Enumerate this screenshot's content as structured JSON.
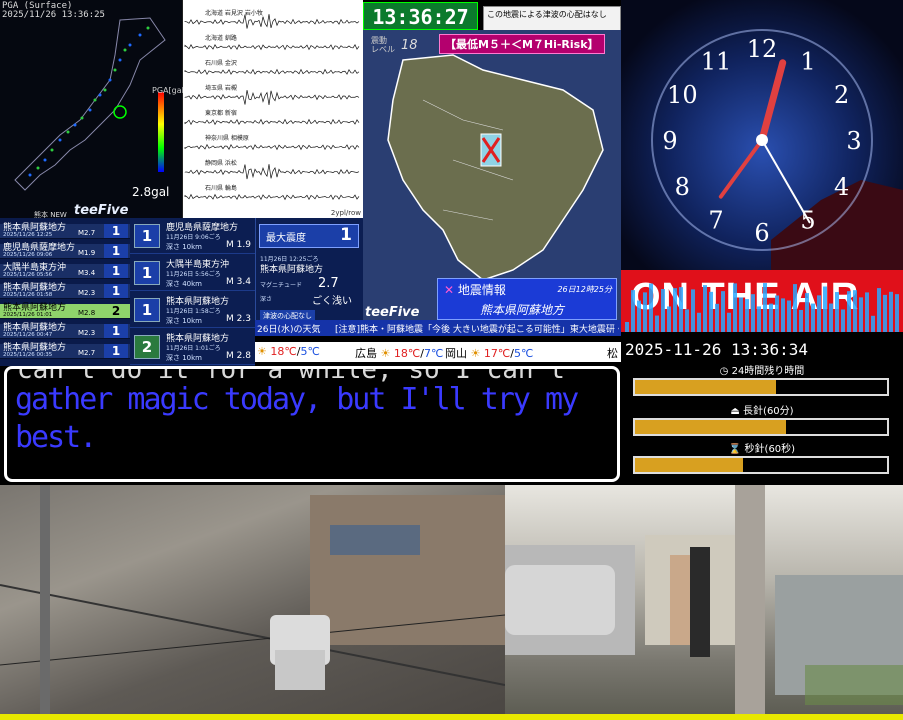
{
  "map_panel": {
    "header_title": "PGA (Surface)",
    "timestamp": "2025/11/26 13:36:25",
    "pga_label": "PGA[gal]",
    "gal_value": "2.8gal",
    "brand": "teeFive",
    "scale_labels": [
      "1000",
      "500",
      "200",
      "100",
      "50",
      "20",
      "10",
      "5",
      "2",
      "1",
      "0.5",
      "0.2",
      "0.1",
      "0.05",
      "0.02",
      "0.01"
    ]
  },
  "waveform_panel": {
    "stations": [
      "北海道 岩見沢 岩小牧",
      "北海道 釧路",
      "石川県 金沢",
      "埼玉県 岩槻",
      "東京都 新宿",
      "神奈川県 相模原",
      "静岡県 浜松",
      "石川県 輪島"
    ],
    "footer": "2ypl/row"
  },
  "clock_green": "13:36:27",
  "tsunami_notice": "この地震による津波の心配はなし",
  "kyushu_panel": {
    "shindo_label": "震動\nレベル",
    "shindo_value": "18",
    "risk_label": "【最低M５＋＜M７Hi-Risk】",
    "info_title": "地震情報",
    "info_time": "26日12時25分",
    "info_place": "熊本県阿蘇地方",
    "brand": "teeFive"
  },
  "quake_list": {
    "new_label": "熊本 NEW",
    "rows": [
      {
        "place": "熊本県阿蘇地方",
        "date": "2025/11/26 12:25",
        "mag": "M2.7",
        "shindo": "1",
        "highlight": false
      },
      {
        "place": "鹿児島県薩摩地方",
        "date": "2025/11/26 09:06",
        "mag": "M1.9",
        "shindo": "1",
        "highlight": false
      },
      {
        "place": "大隅半島東方沖",
        "date": "2025/11/26 05:56",
        "mag": "M3.4",
        "shindo": "1",
        "highlight": false
      },
      {
        "place": "熊本県阿蘇地方",
        "date": "2025/11/26 01:58",
        "mag": "M2.3",
        "shindo": "1",
        "highlight": false
      },
      {
        "place": "熊本県阿蘇地方",
        "date": "2025/11/26 01:01",
        "mag": "M2.8",
        "shindo": "2",
        "highlight": true
      },
      {
        "place": "熊本県阿蘇地方",
        "date": "2025/11/26 00:47",
        "mag": "M2.3",
        "shindo": "1",
        "highlight": false
      },
      {
        "place": "熊本県阿蘇地方",
        "date": "2025/11/26 00:35",
        "mag": "M2.7",
        "shindo": "1",
        "highlight": false
      }
    ]
  },
  "detail_list": {
    "rows": [
      {
        "place": "鹿児島県薩摩地方",
        "time": "11月26日 9:06ごろ",
        "depth": "深さ 10km",
        "mag": "M 1.9",
        "shindo": "1",
        "highlight": false
      },
      {
        "place": "大隅半島東方沖",
        "time": "11月26日 5:56ごろ",
        "depth": "深さ 40km",
        "mag": "M 3.4",
        "shindo": "1",
        "highlight": false
      },
      {
        "place": "熊本県阿蘇地方",
        "time": "11月26日 1:58ごろ",
        "depth": "深さ 10km",
        "mag": "M 2.3",
        "shindo": "1",
        "highlight": false
      },
      {
        "place": "熊本県阿蘇地方",
        "time": "11月26日 1:01ごろ",
        "depth": "深さ 10km",
        "mag": "M 2.8",
        "shindo": "2",
        "highlight": true
      }
    ]
  },
  "max_panel": {
    "label": "最大震度",
    "value": "1",
    "time": "11月26日 12:25ごろ",
    "place": "熊本県阿蘇地方",
    "mag_label": "マグニチュード",
    "mag_value": "2.7",
    "depth_label": "深さ",
    "depth_value": "ごく浅い",
    "tsunami": "津波の心配なし"
  },
  "ticker": {
    "date": "26日(水)の天気",
    "news": "[注意]熊本・阿蘇地震「今後 大きい地震が起こる可能性」東大地震研・笠原教授"
  },
  "weather": [
    {
      "city": "",
      "hi": "18℃",
      "lo": "5℃"
    },
    {
      "city": "広島",
      "hi": "18℃",
      "lo": "7℃"
    },
    {
      "city": "岡山",
      "hi": "17℃",
      "lo": "5℃"
    },
    {
      "city": "松",
      "hi": "",
      "lo": ""
    }
  ],
  "clock_panel": {
    "numbers": [
      "12",
      "1",
      "2",
      "3",
      "4",
      "5",
      "6",
      "7",
      "8",
      "9",
      "10",
      "11"
    ],
    "hour_hand_deg": 15,
    "minute_hand_deg": 216,
    "second_hand_deg": 150
  },
  "on_air": "ON THE AIR",
  "remaining": {
    "datetime": "2025-11-26 13:36:34",
    "day_label": "24時間残り時間",
    "day_fill": 0.56,
    "minute_label": "長針(60分)",
    "minute_fill": 0.6,
    "second_label": "秒針(60秒)",
    "second_fill": 0.43
  },
  "dialog": {
    "top_line": "can't do it for a while, so I can't",
    "text": "gather magic today, but I'll try my best."
  },
  "colors": {
    "accent_yellow": "#e8e800",
    "dialog_text": "#3a3aff",
    "onair_red": "#e0101a",
    "bar_fill": "#d8a020"
  }
}
